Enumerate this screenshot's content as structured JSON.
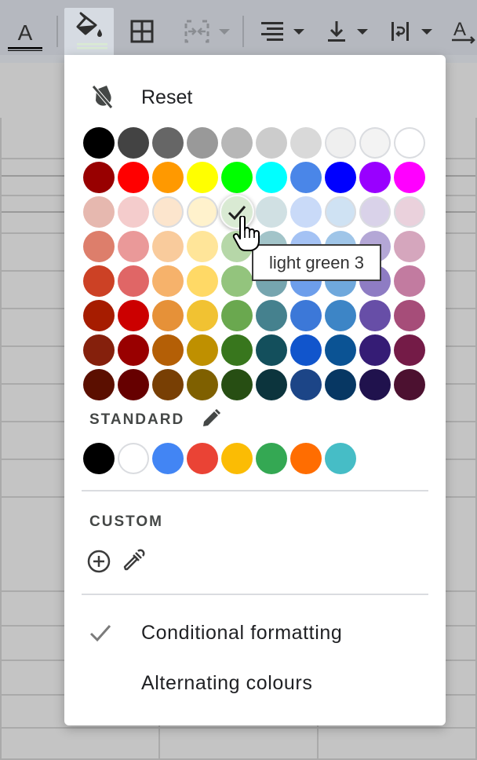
{
  "toolbar": {
    "buttons": [
      {
        "name": "text-color",
        "icon": "text-color-icon"
      },
      {
        "name": "fill-color",
        "icon": "paint-bucket-icon",
        "active": true,
        "current_color": "#d9ead3"
      },
      {
        "name": "borders",
        "icon": "borders-icon"
      },
      {
        "name": "merge-cells",
        "icon": "merge-cells-icon",
        "disabled": true
      },
      {
        "name": "horizontal-align",
        "icon": "align-icon"
      },
      {
        "name": "vertical-align",
        "icon": "vertical-align-bottom-icon"
      },
      {
        "name": "text-wrapping",
        "icon": "text-wrap-icon"
      },
      {
        "name": "text-rotation",
        "icon": "text-rotation-icon"
      }
    ]
  },
  "menu": {
    "reset_label": "Reset",
    "palette": [
      [
        {
          "name": "black",
          "hex": "#000000"
        },
        {
          "name": "dark grey 4",
          "hex": "#434343"
        },
        {
          "name": "dark grey 3",
          "hex": "#666666"
        },
        {
          "name": "dark grey 2",
          "hex": "#999999"
        },
        {
          "name": "dark grey 1",
          "hex": "#b7b7b7"
        },
        {
          "name": "grey",
          "hex": "#cccccc"
        },
        {
          "name": "light grey 1",
          "hex": "#d9d9d9"
        },
        {
          "name": "light grey 2",
          "hex": "#efefef"
        },
        {
          "name": "light grey 3",
          "hex": "#f3f3f3"
        },
        {
          "name": "white",
          "hex": "#ffffff"
        }
      ],
      [
        {
          "name": "red berry",
          "hex": "#980000"
        },
        {
          "name": "red",
          "hex": "#ff0000"
        },
        {
          "name": "orange",
          "hex": "#ff9900"
        },
        {
          "name": "yellow",
          "hex": "#ffff00"
        },
        {
          "name": "green",
          "hex": "#00ff00"
        },
        {
          "name": "cyan",
          "hex": "#00ffff"
        },
        {
          "name": "cornflower blue",
          "hex": "#4a86e8"
        },
        {
          "name": "blue",
          "hex": "#0000ff"
        },
        {
          "name": "purple",
          "hex": "#9900ff"
        },
        {
          "name": "magenta",
          "hex": "#ff00ff"
        }
      ],
      [
        {
          "name": "light red berry 3",
          "hex": "#e6b8af"
        },
        {
          "name": "light red 3",
          "hex": "#f4cccc"
        },
        {
          "name": "light orange 3",
          "hex": "#fce5cd"
        },
        {
          "name": "light yellow 3",
          "hex": "#fff2cc"
        },
        {
          "name": "light green 3",
          "hex": "#d9ead3"
        },
        {
          "name": "light cyan 3",
          "hex": "#d0e0e3"
        },
        {
          "name": "light cornflower blue 3",
          "hex": "#c9daf8"
        },
        {
          "name": "light blue 3",
          "hex": "#cfe2f3"
        },
        {
          "name": "light purple 3",
          "hex": "#d9d2e9"
        },
        {
          "name": "light magenta 3",
          "hex": "#ead1dc"
        }
      ],
      [
        {
          "name": "light red berry 2",
          "hex": "#dd7e6b"
        },
        {
          "name": "light red 2",
          "hex": "#ea9999"
        },
        {
          "name": "light orange 2",
          "hex": "#f9cb9c"
        },
        {
          "name": "light yellow 2",
          "hex": "#ffe599"
        },
        {
          "name": "light green 2",
          "hex": "#b6d7a8"
        },
        {
          "name": "light cyan 2",
          "hex": "#a2c4c9"
        },
        {
          "name": "light cornflower blue 2",
          "hex": "#a4c2f4"
        },
        {
          "name": "light blue 2",
          "hex": "#9fc5e8"
        },
        {
          "name": "light purple 2",
          "hex": "#b4a7d6"
        },
        {
          "name": "light magenta 2",
          "hex": "#d5a6bd"
        }
      ],
      [
        {
          "name": "light red berry 1",
          "hex": "#cc4125"
        },
        {
          "name": "light red 1",
          "hex": "#e06666"
        },
        {
          "name": "light orange 1",
          "hex": "#f6b26b"
        },
        {
          "name": "light yellow 1",
          "hex": "#ffd966"
        },
        {
          "name": "light green 1",
          "hex": "#93c47d"
        },
        {
          "name": "light cyan 1",
          "hex": "#76a5af"
        },
        {
          "name": "light cornflower blue 1",
          "hex": "#6d9eeb"
        },
        {
          "name": "light blue 1",
          "hex": "#6fa8dc"
        },
        {
          "name": "light purple 1",
          "hex": "#8e7cc3"
        },
        {
          "name": "light magenta 1",
          "hex": "#c27ba0"
        }
      ],
      [
        {
          "name": "dark red berry 1",
          "hex": "#a61c00"
        },
        {
          "name": "dark red 1",
          "hex": "#cc0000"
        },
        {
          "name": "dark orange 1",
          "hex": "#e69138"
        },
        {
          "name": "dark yellow 1",
          "hex": "#f1c232"
        },
        {
          "name": "dark green 1",
          "hex": "#6aa84f"
        },
        {
          "name": "dark cyan 1",
          "hex": "#45818e"
        },
        {
          "name": "dark cornflower blue 1",
          "hex": "#3c78d8"
        },
        {
          "name": "dark blue 1",
          "hex": "#3d85c6"
        },
        {
          "name": "dark purple 1",
          "hex": "#674ea7"
        },
        {
          "name": "dark magenta 1",
          "hex": "#a64d79"
        }
      ],
      [
        {
          "name": "dark red berry 2",
          "hex": "#85200c"
        },
        {
          "name": "dark red 2",
          "hex": "#990000"
        },
        {
          "name": "dark orange 2",
          "hex": "#b45f06"
        },
        {
          "name": "dark yellow 2",
          "hex": "#bf9000"
        },
        {
          "name": "dark green 2",
          "hex": "#38761d"
        },
        {
          "name": "dark cyan 2",
          "hex": "#134f5c"
        },
        {
          "name": "dark cornflower blue 2",
          "hex": "#1155cc"
        },
        {
          "name": "dark blue 2",
          "hex": "#0b5394"
        },
        {
          "name": "dark purple 2",
          "hex": "#351c75"
        },
        {
          "name": "dark magenta 2",
          "hex": "#741b47"
        }
      ],
      [
        {
          "name": "dark red berry 3",
          "hex": "#5b0f00"
        },
        {
          "name": "dark red 3",
          "hex": "#660000"
        },
        {
          "name": "dark orange 3",
          "hex": "#783f04"
        },
        {
          "name": "dark yellow 3",
          "hex": "#7f6000"
        },
        {
          "name": "dark green 3",
          "hex": "#274e13"
        },
        {
          "name": "dark cyan 3",
          "hex": "#0c343d"
        },
        {
          "name": "dark cornflower blue 3",
          "hex": "#1c4587"
        },
        {
          "name": "dark blue 3",
          "hex": "#073763"
        },
        {
          "name": "dark purple 3",
          "hex": "#20124d"
        },
        {
          "name": "dark magenta 3",
          "hex": "#4c1130"
        }
      ]
    ],
    "selected_color": "light green 3",
    "standard_label": "STANDARD",
    "standard_colors": [
      {
        "name": "black",
        "hex": "#000000"
      },
      {
        "name": "white",
        "hex": "#ffffff"
      },
      {
        "name": "blue",
        "hex": "#4285f4"
      },
      {
        "name": "red",
        "hex": "#ea4335"
      },
      {
        "name": "yellow",
        "hex": "#fbbc04"
      },
      {
        "name": "green",
        "hex": "#34a853"
      },
      {
        "name": "orange",
        "hex": "#ff6d01"
      },
      {
        "name": "cyan",
        "hex": "#46bdc6"
      }
    ],
    "custom_label": "CUSTOM",
    "conditional_formatting_label": "Conditional formatting",
    "alternating_colours_label": "Alternating colours"
  },
  "tooltip": {
    "text": "light green 3"
  }
}
